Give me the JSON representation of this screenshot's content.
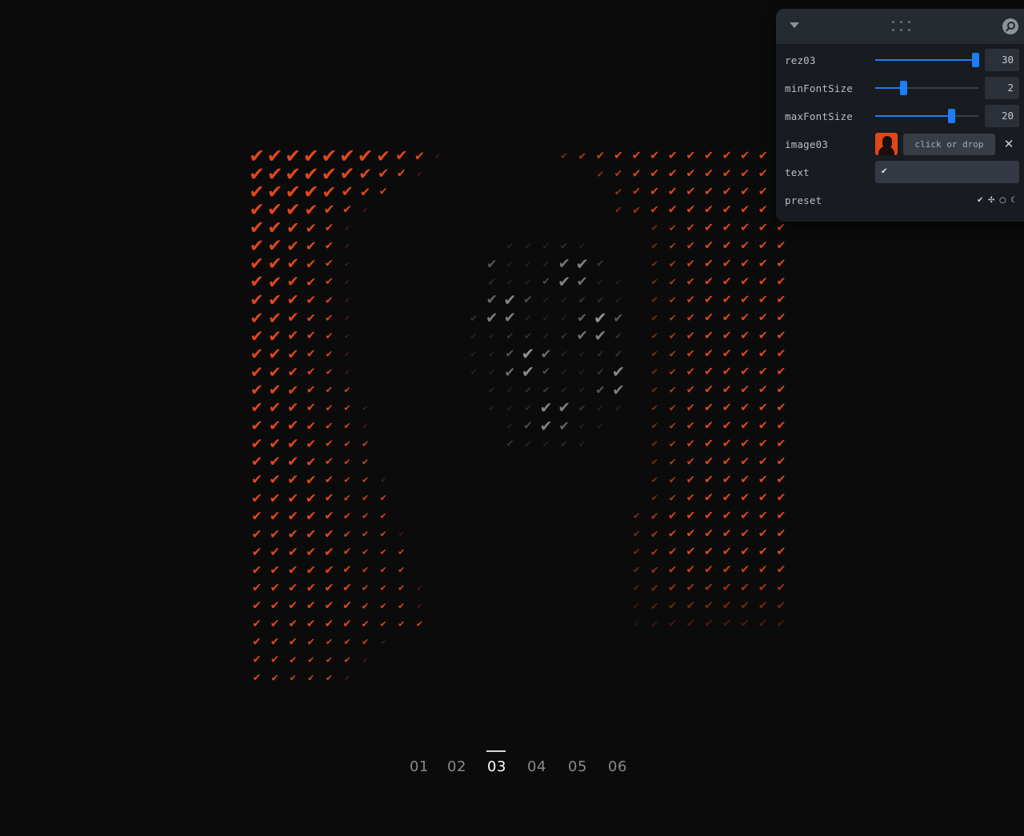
{
  "artwork": {
    "glyph": "✔",
    "colors": {
      "orange": "#e0471a",
      "gray": "#d8d8d8",
      "background": "#0b0b0b"
    }
  },
  "pagination": {
    "pages": [
      "01",
      "02",
      "03",
      "04",
      "05",
      "06"
    ],
    "active": "03"
  },
  "panel": {
    "header": {
      "collapse_icon": "chevron-down-icon",
      "drag_icon": "drag-handle-icon",
      "search_icon": "search-icon"
    },
    "controls": {
      "rez03": {
        "label": "rez03",
        "value": "30",
        "fraction": 0.97
      },
      "minFontSize": {
        "label": "minFontSize",
        "value": "2",
        "fraction": 0.27
      },
      "maxFontSize": {
        "label": "maxFontSize",
        "value": "20",
        "fraction": 0.74
      },
      "image03": {
        "label": "image03",
        "button": "click or drop",
        "clear_icon": "close-icon"
      },
      "text": {
        "label": "text",
        "value": "✔"
      },
      "preset": {
        "label": "preset",
        "options": [
          "✔",
          "✣",
          "○",
          "☾"
        ]
      }
    }
  }
}
